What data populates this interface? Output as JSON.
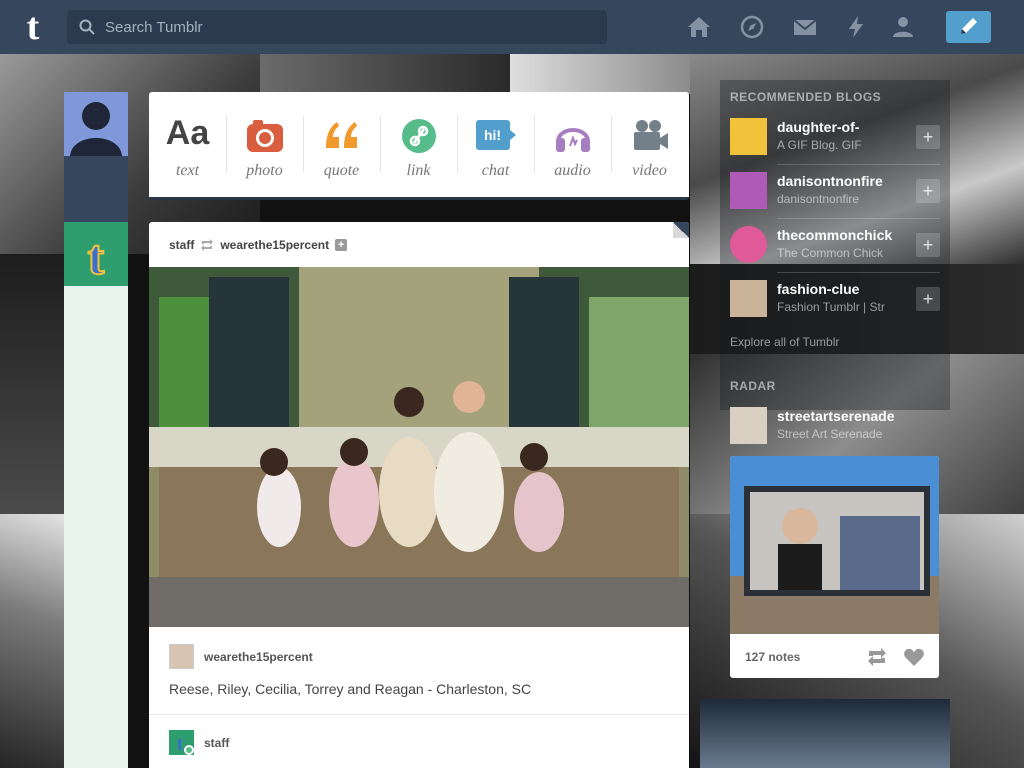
{
  "topbar": {
    "logo": "t",
    "search_placeholder": "Search Tumblr",
    "nav": [
      "home-icon",
      "explore-compass-icon",
      "messages-mail-icon",
      "activity-lightning-icon",
      "account-person-icon"
    ],
    "compose_icon": "pencil-icon",
    "compose_color": "#529ecc"
  },
  "post_types": [
    {
      "label": "text",
      "icon": "Aa",
      "color": "#444444"
    },
    {
      "label": "photo",
      "icon": "camera-icon",
      "color": "#d95e40"
    },
    {
      "label": "quote",
      "icon": "quote-icon",
      "color": "#f2992e"
    },
    {
      "label": "link",
      "icon": "link-icon",
      "color": "#56bc8a"
    },
    {
      "label": "chat",
      "icon": "hi!",
      "color": "#529ecc"
    },
    {
      "label": "audio",
      "icon": "headphones-icon",
      "color": "#a77dc2"
    },
    {
      "label": "video",
      "icon": "video-camera-icon",
      "color": "#748089"
    }
  ],
  "post": {
    "reblogger": "staff",
    "source": "wearethe15percent",
    "caption_user": "wearethe15percent",
    "caption": "Reese, Riley, Cecilia, Torrey and Reagan - Charleston, SC",
    "next_user": "staff"
  },
  "sidebar": {
    "recommended_title": "RECOMMENDED BLOGS",
    "recommended": [
      {
        "name": "daughter-of-",
        "sub": "A GIF Blog. GIF"
      },
      {
        "name": "danisontnonfire",
        "sub": "danisontnonfire"
      },
      {
        "name": "thecommonchick",
        "sub": "The Common Chick"
      },
      {
        "name": "fashion-clue",
        "sub": "Fashion Tumblr | Str"
      }
    ],
    "explore_label": "Explore all of Tumblr",
    "radar_title": "RADAR",
    "radar_blog": {
      "name": "streetartserenade",
      "sub": "Street Art Serenade"
    },
    "radar_notes": "127 notes"
  },
  "colors": {
    "background": "#36465d",
    "accent": "#529ecc",
    "staff_green": "#2f9e6f"
  }
}
